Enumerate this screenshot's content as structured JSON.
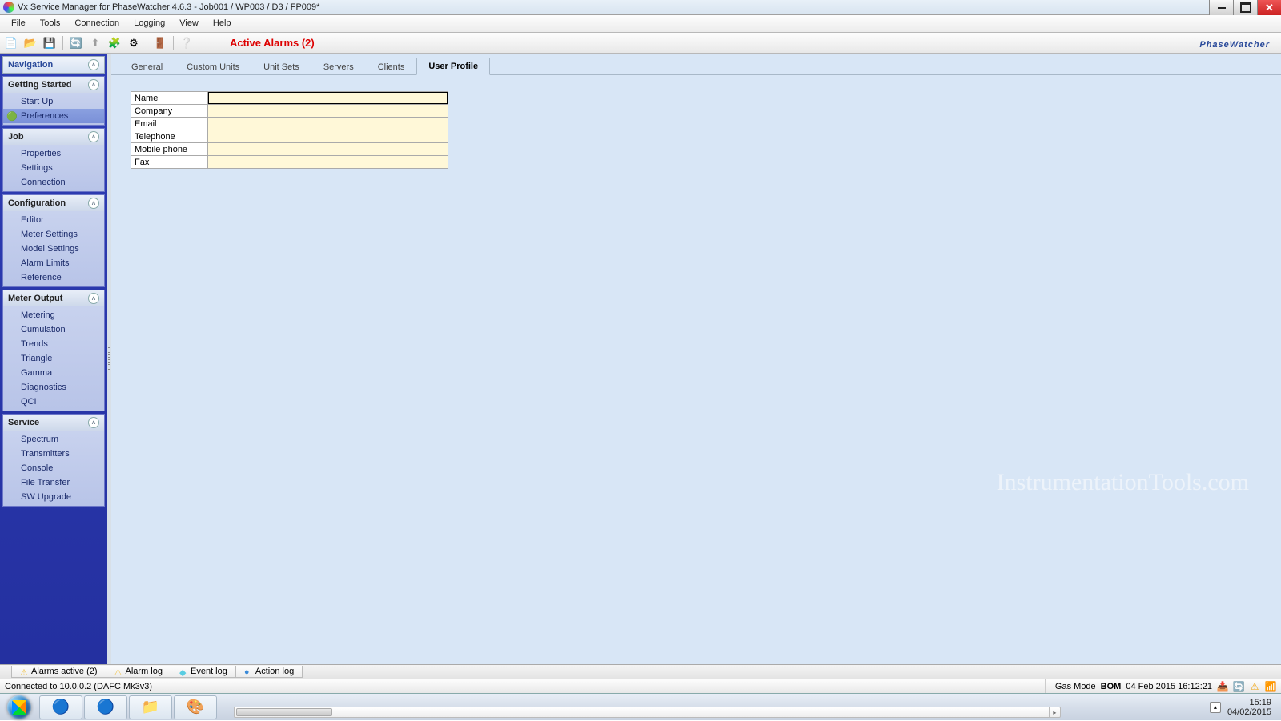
{
  "window": {
    "title": "Vx Service Manager for PhaseWatcher 4.6.3 - Job001 / WP003 / D3 / FP009*"
  },
  "menu": {
    "items": [
      "File",
      "Tools",
      "Connection",
      "Logging",
      "View",
      "Help"
    ]
  },
  "toolbar": {
    "alarm_label": "Active Alarms (2)",
    "brand_a": "Phase",
    "brand_b": "Watcher"
  },
  "nav": {
    "header": "Navigation",
    "groups": [
      {
        "title": "Getting Started",
        "items": [
          "Start Up",
          "Preferences"
        ],
        "icons": [
          "",
          "🟢"
        ]
      },
      {
        "title": "Job",
        "items": [
          "Properties",
          "Settings",
          "Connection"
        ],
        "icons": [
          "",
          "",
          ""
        ]
      },
      {
        "title": "Configuration",
        "items": [
          "Editor",
          "Meter Settings",
          "Model Settings",
          "Alarm Limits",
          "Reference"
        ],
        "icons": [
          "",
          "",
          "",
          "",
          ""
        ]
      },
      {
        "title": "Meter Output",
        "items": [
          "Metering",
          "Cumulation",
          "Trends",
          "Triangle",
          "Gamma",
          "Diagnostics",
          "QCI"
        ],
        "icons": [
          "",
          "",
          "",
          "",
          "",
          "",
          ""
        ]
      },
      {
        "title": "Service",
        "items": [
          "Spectrum",
          "Transmitters",
          "Console",
          "File Transfer",
          "SW Upgrade"
        ],
        "icons": [
          "",
          "",
          "",
          "",
          ""
        ]
      }
    ]
  },
  "tabs": {
    "items": [
      "General",
      "Custom Units",
      "Unit Sets",
      "Servers",
      "Clients",
      "User Profile"
    ],
    "active": 5
  },
  "profile_fields": [
    "Name",
    "Company",
    "Email",
    "Telephone",
    "Mobile phone",
    "Fax"
  ],
  "watermark": "InstrumentationTools.com",
  "bottom_tabs": [
    {
      "icon": "⚠",
      "color": "#f0c040",
      "label": "Alarms active (2)"
    },
    {
      "icon": "⚠",
      "color": "#f0c040",
      "label": "Alarm log"
    },
    {
      "icon": "◆",
      "color": "#59cde2",
      "label": "Event log"
    },
    {
      "icon": "●",
      "color": "#3a8ad8",
      "label": "Action log"
    }
  ],
  "status": {
    "connected": "Connected to 10.0.0.2 (DAFC Mk3v3)",
    "mode_label": "Gas Mode",
    "mode_value": "BOM",
    "datetime": "04 Feb 2015 16:12:21"
  },
  "tray": {
    "time": "15:19",
    "date": "04/02/2015"
  }
}
